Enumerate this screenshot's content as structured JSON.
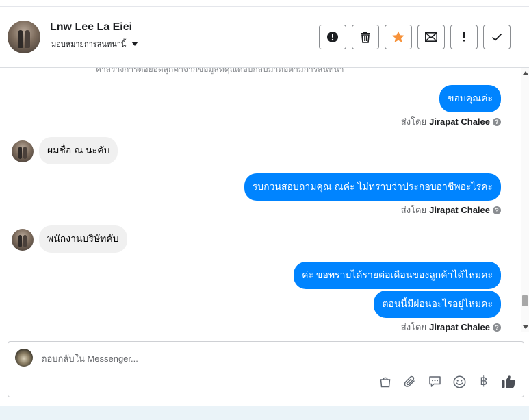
{
  "header": {
    "contact_name": "Lnw Lee La Eiei",
    "assign_label": "มอบหมายการสนทนานี้",
    "actions": [
      {
        "name": "spam-button",
        "icon": "exclamation-circle-icon"
      },
      {
        "name": "delete-button",
        "icon": "trash-icon"
      },
      {
        "name": "star-button",
        "icon": "star-icon",
        "color": "#f7923a"
      },
      {
        "name": "mark-unread-button",
        "icon": "envelope-icon"
      },
      {
        "name": "follow-up-button",
        "icon": "exclamation-icon"
      },
      {
        "name": "mark-done-button",
        "icon": "checkmark-icon"
      }
    ]
  },
  "thread": {
    "cut_line": "ค่าสร้างการต่อยอดลูกค้าจากข้อมูลที่คุณตอบกลับมาต่อตามการสนทนา",
    "messages": [
      {
        "from": "page",
        "text": "ขอบคุณค่ะ"
      },
      {
        "from": "user",
        "text": "ผมชื่อ ณ นะคับ"
      },
      {
        "from": "page",
        "text": "รบกวนสอบถามคุณ ณค่ะ ไม่ทราบว่าประกอบอาชีพอะไรคะ"
      },
      {
        "from": "user",
        "text": "พนักงานบริษัทคับ"
      },
      {
        "from": "page",
        "text": "ค่ะ ขอทราบได้รายต่อเดือนของลูกค้าได้ไหมคะ"
      },
      {
        "from": "page",
        "text": "ตอนนี้มีผ่อนอะไรอยู่ไหมคะ"
      }
    ],
    "sent_by_prefix": "ส่งโดย",
    "sent_by_name": "Jirapat Chalee",
    "help_glyph": "?"
  },
  "composer": {
    "placeholder": "ตอบกลับใน Messenger...",
    "value": "",
    "tools": [
      "bag-icon",
      "paperclip-icon",
      "saved-reply-icon",
      "emoji-icon",
      "baht-icon",
      "thumbs-up-icon"
    ],
    "baht_glyph": "฿"
  },
  "colors": {
    "outgoing_bubble": "#0084ff",
    "incoming_bubble": "#f0f0f0",
    "star": "#f7923a"
  }
}
